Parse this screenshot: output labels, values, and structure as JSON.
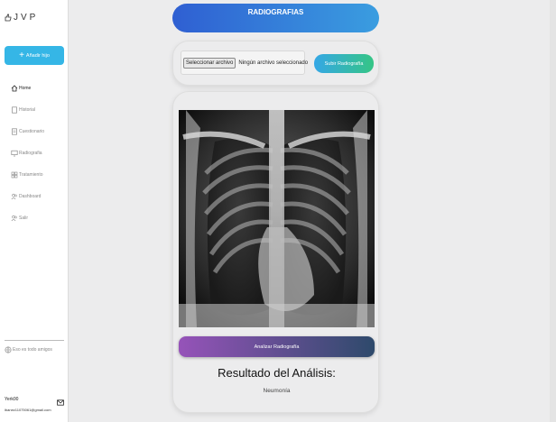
{
  "sidebar": {
    "logo": "JVP",
    "add_button": "Añadir hijo",
    "nav": [
      {
        "label": "Home",
        "icon": "home-icon",
        "active": true
      },
      {
        "label": "Historial",
        "icon": "document-icon",
        "active": false
      },
      {
        "label": "Cuestionario",
        "icon": "document-icon",
        "active": false
      },
      {
        "label": "Radiografia",
        "icon": "monitor-icon",
        "active": false
      },
      {
        "label": "Tratamiento",
        "icon": "grid-icon",
        "active": false
      },
      {
        "label": "Dashboard",
        "icon": "users-icon",
        "active": false
      },
      {
        "label": "Salir",
        "icon": "users-icon",
        "active": false
      }
    ],
    "language": "Eso es todo amigos",
    "user_name": "Yerk00",
    "user_email": "ibanez11075061@gmail.com"
  },
  "header": {
    "title": "RADIOGRAFIAS"
  },
  "upload": {
    "file_button": "Seleccionar archivo",
    "file_status": "Ningún archivo seleccionado",
    "upload_button": "Subir Radiografía"
  },
  "result": {
    "analyze_button": "Analizar Radiografía",
    "title": "Resultado del Análisis:",
    "value": "Neumonía"
  },
  "colors": {
    "accent": "#35b6e6",
    "header_start": "#2f5fd2",
    "header_end": "#3a9de0",
    "analyze_start": "#9653b9",
    "analyze_end": "#2e4a6b"
  }
}
